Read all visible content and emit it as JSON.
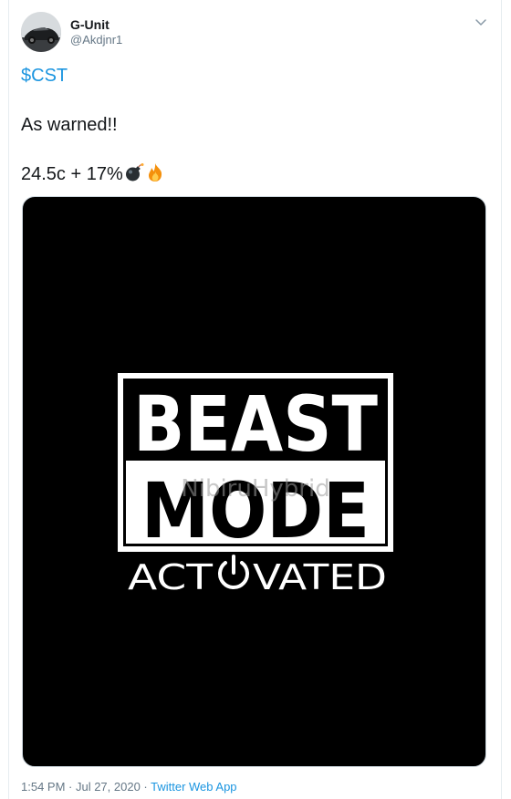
{
  "tweet": {
    "display_name": "G-Unit",
    "handle": "@Akdjnr1",
    "cashtag": "$CST",
    "line2": "As warned!!",
    "line3": "24.5c + 17%",
    "emojis": [
      "bomb-icon",
      "fire-icon"
    ],
    "timestamp": "1:54 PM · Jul 27, 2020 · ",
    "source": "Twitter Web App"
  },
  "media": {
    "line1": "BEAST",
    "line2": "MODE",
    "left_part": "ACT",
    "right_part": "VATED",
    "watermark": "NibiruHybrid"
  },
  "colors": {
    "link": "#1b95e0",
    "secondary": "#657786"
  }
}
